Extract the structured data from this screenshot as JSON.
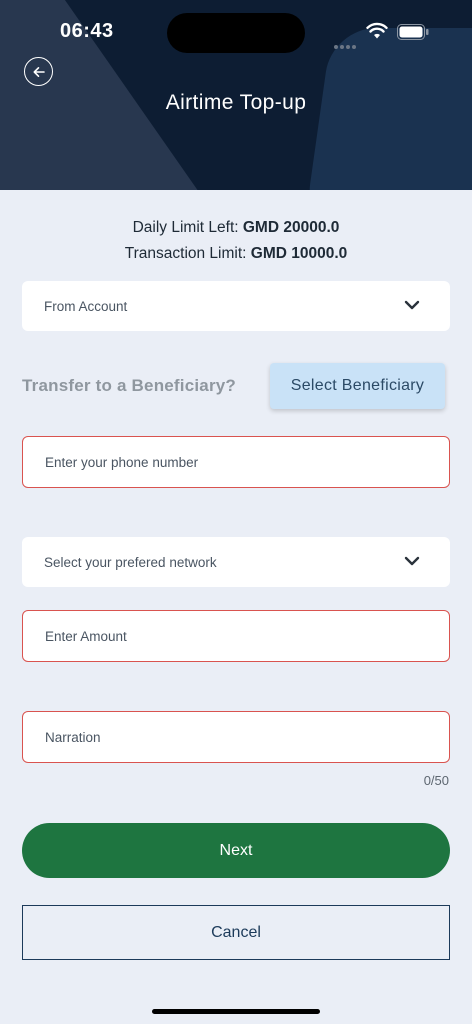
{
  "status_bar": {
    "time": "06:43"
  },
  "header": {
    "title": "Airtime Top-up"
  },
  "limits": {
    "daily_label": "Daily Limit Left:",
    "daily_value": "GMD 20000.0",
    "transaction_label": "Transaction Limit:",
    "transaction_value": "GMD 10000.0"
  },
  "form": {
    "from_account": {
      "placeholder": "From Account"
    },
    "transfer_label": "Transfer to a Beneficiary?",
    "select_beneficiary_label": "Select Beneficiary",
    "phone": {
      "placeholder": "Enter your phone number",
      "value": ""
    },
    "network": {
      "placeholder": "Select your prefered network"
    },
    "amount": {
      "placeholder": "Enter Amount",
      "value": ""
    },
    "narration": {
      "placeholder": "Narration",
      "value": "",
      "counter": "0/50"
    }
  },
  "actions": {
    "next_label": "Next",
    "cancel_label": "Cancel"
  },
  "icons": {
    "back": "arrow-left-circle-icon",
    "dropdown": "chevron-down-icon",
    "wifi": "wifi-icon",
    "battery": "battery-icon",
    "signal": "signal-dots-icon"
  },
  "colors": {
    "header_bg": "#0d1d33",
    "page_bg": "#eaeef6",
    "primary_green": "#1e7540",
    "error_border": "#d9534f",
    "beneficiary_bg": "#c9e2f7",
    "cancel_border": "#1c3a5a"
  }
}
